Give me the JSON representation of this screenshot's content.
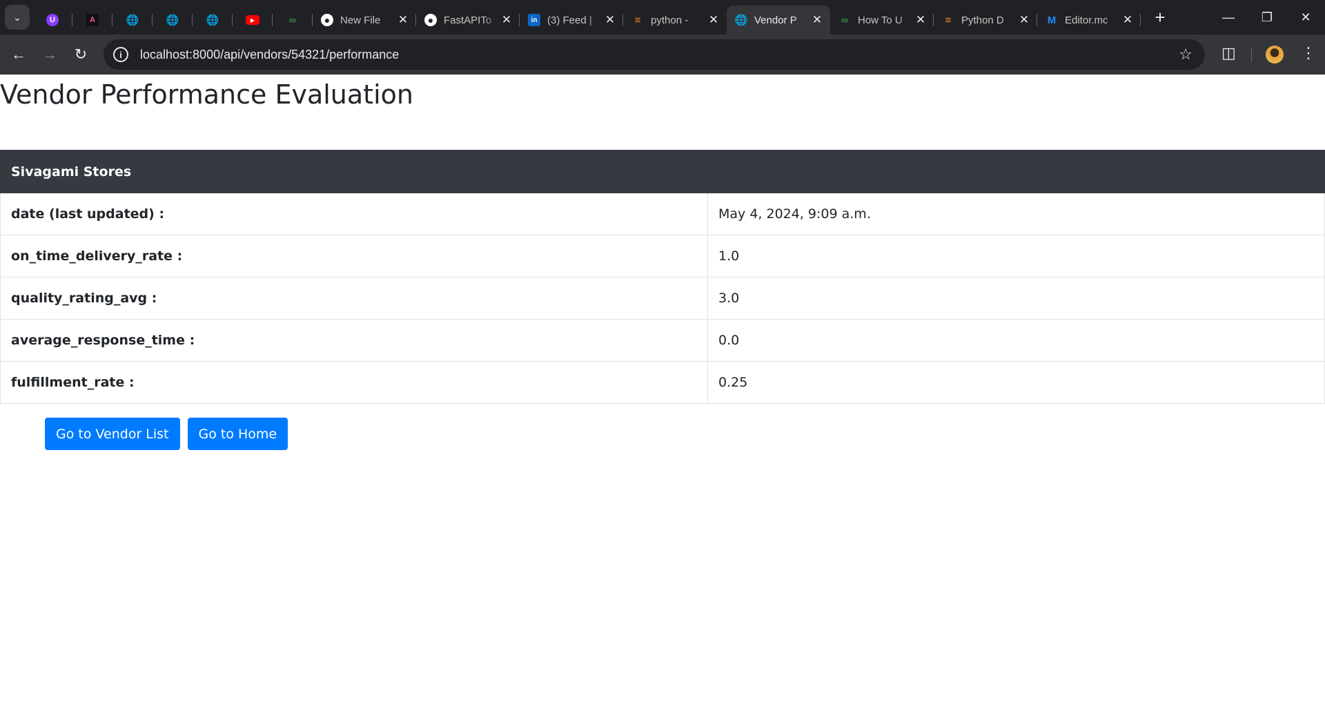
{
  "browser": {
    "tabs": [
      {
        "type": "pinned",
        "icon": "uscreen-icon",
        "color": "#8b3dff"
      },
      {
        "type": "pinned",
        "icon": "affinity-icon",
        "color": "#111111"
      },
      {
        "type": "pinned",
        "icon": "globe-icon",
        "color": "#9aa0a6"
      },
      {
        "type": "pinned",
        "icon": "globe-icon",
        "color": "#9aa0a6"
      },
      {
        "type": "pinned",
        "icon": "globe-icon",
        "color": "#9aa0a6"
      },
      {
        "type": "pinned",
        "icon": "youtube-icon",
        "color": "#ff0000"
      },
      {
        "type": "pinned",
        "icon": "geeksforgeeks-icon",
        "color": "#2f8d46"
      },
      {
        "type": "normal",
        "icon": "github-icon",
        "title": "New File",
        "color": "#ffffff"
      },
      {
        "type": "normal",
        "icon": "github-icon",
        "title": "FastAPITo",
        "color": "#ffffff"
      },
      {
        "type": "normal",
        "icon": "linkedin-icon",
        "title": "(3) Feed |",
        "color": "#0a66c2"
      },
      {
        "type": "normal",
        "icon": "stackoverflow-icon",
        "title": "python -",
        "color": "#f48024"
      },
      {
        "type": "normal",
        "icon": "globe-icon",
        "title": "Vendor P",
        "color": "#9aa0a6",
        "active": true
      },
      {
        "type": "normal",
        "icon": "geeksforgeeks-icon",
        "title": "How To U",
        "color": "#2f8d46"
      },
      {
        "type": "normal",
        "icon": "stackoverflow-icon",
        "title": "Python D",
        "color": "#f48024"
      },
      {
        "type": "normal",
        "icon": "medium-icon",
        "title": "Editor.mc",
        "color": "#1a8cff"
      }
    ],
    "url": "localhost:8000/api/vendors/54321/performance"
  },
  "page": {
    "title": "Vendor Performance Evaluation",
    "vendor_name": "Sivagami Stores",
    "rows": [
      {
        "label": "date (last updated) :",
        "value": "May 4, 2024, 9:09 a.m."
      },
      {
        "label": "on_time_delivery_rate :",
        "value": "1.0"
      },
      {
        "label": "quality_rating_avg :",
        "value": "3.0"
      },
      {
        "label": "average_response_time :",
        "value": "0.0"
      },
      {
        "label": "fulfillment_rate :",
        "value": "0.25"
      }
    ],
    "buttons": {
      "vendor_list": "Go to Vendor List",
      "home": "Go to Home"
    }
  },
  "colors": {
    "chrome_dark": "#202124",
    "chrome_toolbar": "#35363a",
    "table_header": "#343a40",
    "button_primary": "#007bff"
  }
}
